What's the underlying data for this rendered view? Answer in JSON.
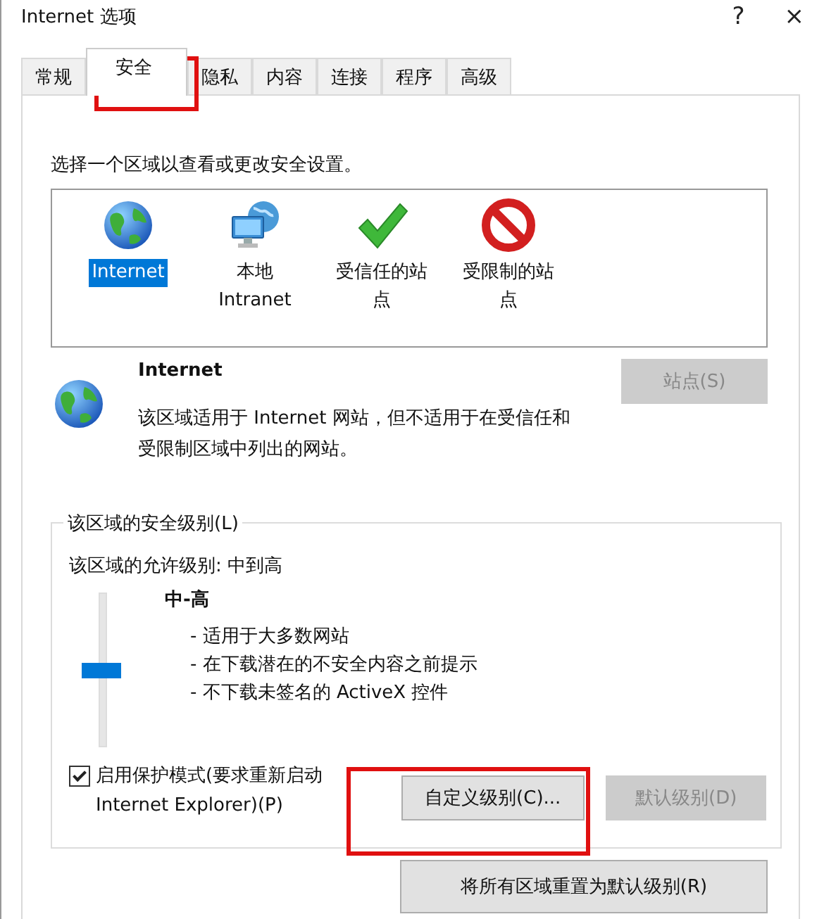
{
  "window": {
    "title": "Internet 选项",
    "help": "?",
    "close": "×"
  },
  "tabs": [
    {
      "label": "常规",
      "selected": false
    },
    {
      "label": "安全",
      "selected": true
    },
    {
      "label": "隐私",
      "selected": false
    },
    {
      "label": "内容",
      "selected": false
    },
    {
      "label": "连接",
      "selected": false
    },
    {
      "label": "程序",
      "selected": false
    },
    {
      "label": "高级",
      "selected": false
    }
  ],
  "zone_prompt": "选择一个区域以查看或更改安全设置。",
  "zones": [
    {
      "kind": "globe",
      "label": "Internet",
      "selected": true
    },
    {
      "kind": "intranet",
      "label": "本地 Intranet",
      "selected": false
    },
    {
      "kind": "trusted",
      "label": "受信任的站点",
      "selected": false
    },
    {
      "kind": "restricted",
      "label": "受限制的站点",
      "selected": false
    }
  ],
  "zone_info": {
    "kind": "globe",
    "title": "Internet",
    "description": "该区域适用于 Internet 网站，但不适用于在受信任和受限制区域中列出的网站。",
    "sites_button": {
      "label": "站点(S)",
      "disabled": true
    }
  },
  "security_level": {
    "legend": "该区域的安全级别(L)",
    "allowed": "该区域的允许级别: 中到高",
    "level": 0.5,
    "level_name": "中-高",
    "bullets": [
      "- 适用于大多数网站",
      "- 在下载潜在的不安全内容之前提示",
      "- 不下载未签名的 ActiveX 控件"
    ],
    "protected_mode": {
      "label": "启用保护模式(要求重新启动 Internet Explorer)(P)",
      "checked": true
    },
    "custom_button": {
      "label": "自定义级别(C)...",
      "disabled": false
    },
    "default_button": {
      "label": "默认级别(D)",
      "disabled": true
    }
  },
  "reset_button": {
    "label": "将所有区域重置为默认级别(R)",
    "disabled": false
  }
}
